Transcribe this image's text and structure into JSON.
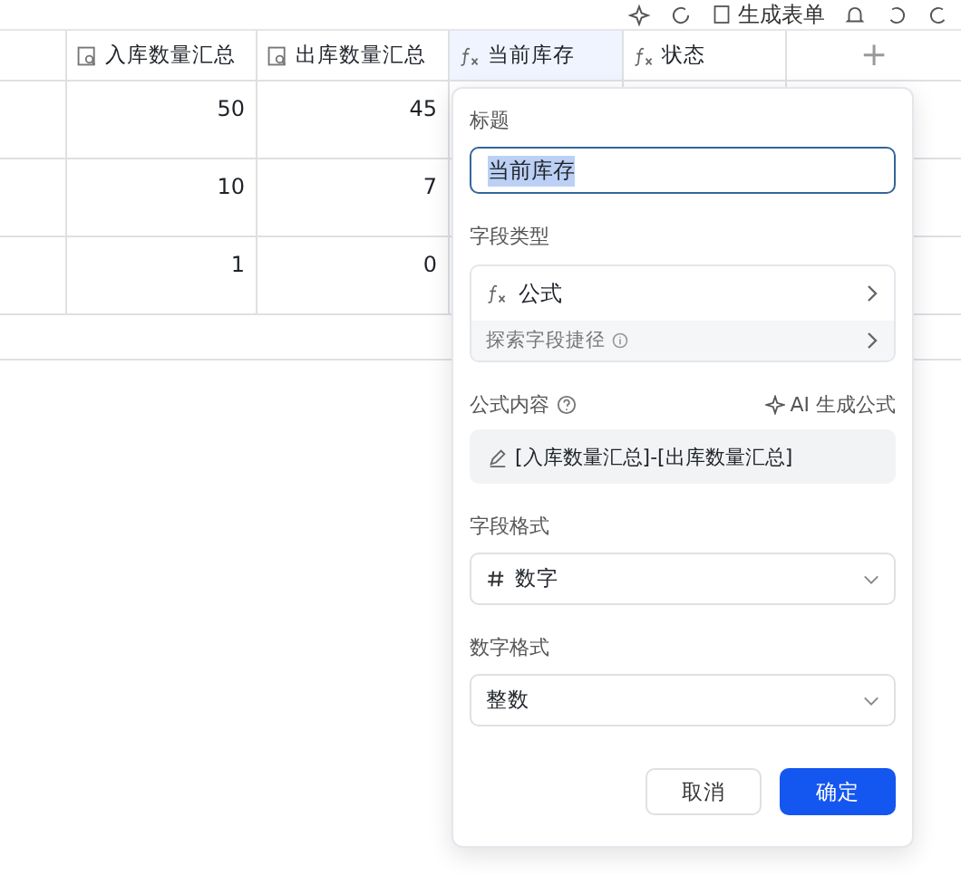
{
  "toolbar": {
    "form_button": "生成表单"
  },
  "table": {
    "columns": [
      {
        "label": "入库数量汇总",
        "kind": "lookup",
        "selected": false
      },
      {
        "label": "出库数量汇总",
        "kind": "lookup",
        "selected": false
      },
      {
        "label": "当前库存",
        "kind": "formula",
        "selected": true
      },
      {
        "label": "状态",
        "kind": "formula",
        "selected": false
      }
    ],
    "add_column": "+",
    "rows": [
      {
        "cells": [
          "50",
          "45"
        ]
      },
      {
        "cells": [
          "10",
          "7"
        ]
      },
      {
        "cells": [
          "1",
          "0"
        ]
      }
    ]
  },
  "popover": {
    "title_label": "标题",
    "title_value": "当前库存",
    "field_type_label": "字段类型",
    "field_type": "公式",
    "explore_link": "探索字段捷径",
    "formula_label": "公式内容",
    "ai_button": "AI 生成公式",
    "formula": "[入库数量汇总]-[出库数量汇总]",
    "format_label": "字段格式",
    "format_value": "数字",
    "number_format_label": "数字格式",
    "number_format_value": "整数",
    "cancel": "取消",
    "ok": "确定"
  }
}
